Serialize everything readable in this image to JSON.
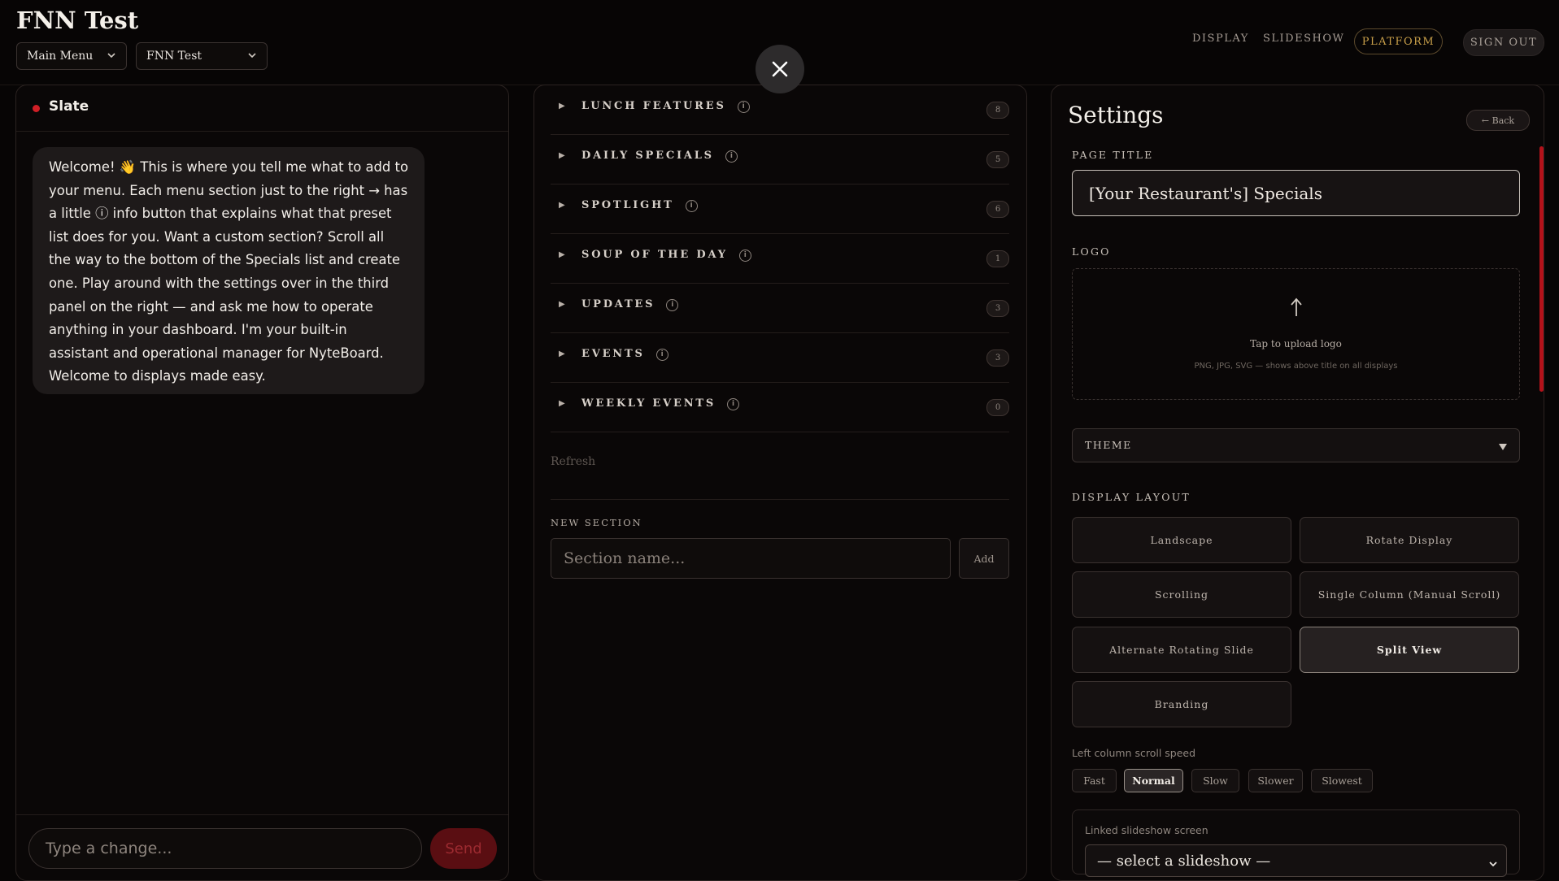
{
  "header": {
    "title": "FNN Test",
    "menu_select": "Main Menu",
    "location_select": "FNN Test",
    "nav": {
      "display": "DISPLAY",
      "slideshow": "SLIDESHOW",
      "platform": "PLATFORM",
      "sign_out": "SIGN OUT"
    }
  },
  "chat": {
    "name": "Slate",
    "message": "Welcome! 👋 This is where you tell me what to add to your menu. Each menu section just to the right → has a little ⓘ info button that explains what that preset list does for you. Want a custom section? Scroll all the way to the bottom of the Specials list and create one. Play around with the settings over in the third panel on the right — and ask me how to operate anything in your dashboard. I'm your built-in assistant and operational manager for NyteBoard. Welcome to displays made easy.",
    "input_placeholder": "Type a change...",
    "send_label": "Send"
  },
  "sections": {
    "items": [
      {
        "name": "LUNCH FEATURES",
        "count": "8"
      },
      {
        "name": "DAILY SPECIALS",
        "count": "5"
      },
      {
        "name": "SPOTLIGHT",
        "count": "6"
      },
      {
        "name": "SOUP OF THE DAY",
        "count": "1"
      },
      {
        "name": "UPDATES",
        "count": "3"
      },
      {
        "name": "EVENTS",
        "count": "3"
      },
      {
        "name": "WEEKLY EVENTS",
        "count": "0"
      }
    ],
    "refresh_label": "Refresh",
    "new_section_label": "NEW SECTION",
    "new_section_placeholder": "Section name...",
    "add_label": "Add"
  },
  "settings": {
    "title": "Settings",
    "back_label": "← Back",
    "page_title_label": "PAGE TITLE",
    "page_title_value": "[Your Restaurant's] Specials",
    "logo_label": "LOGO",
    "logo_upload_text": "Tap to upload logo",
    "logo_hint": "PNG, JPG, SVG — shows above title on all displays",
    "theme_label": "THEME",
    "display_layout_label": "DISPLAY LAYOUT",
    "layouts": [
      "Landscape",
      "Rotate Display",
      "Scrolling",
      "Single Column (Manual Scroll)",
      "Alternate Rotating Slide",
      "Split View",
      "Branding"
    ],
    "selected_layout": "Split View",
    "scroll_speed_label": "Left column scroll speed",
    "speeds": [
      "Fast",
      "Normal",
      "Slow",
      "Slower",
      "Slowest"
    ],
    "selected_speed": "Normal",
    "linked_label": "Linked slideshow screen",
    "linked_select": "— select a slideshow —"
  },
  "colors": {
    "accent_red": "#d01f26",
    "platform_gold": "#c9a04a",
    "background": "#070505"
  }
}
